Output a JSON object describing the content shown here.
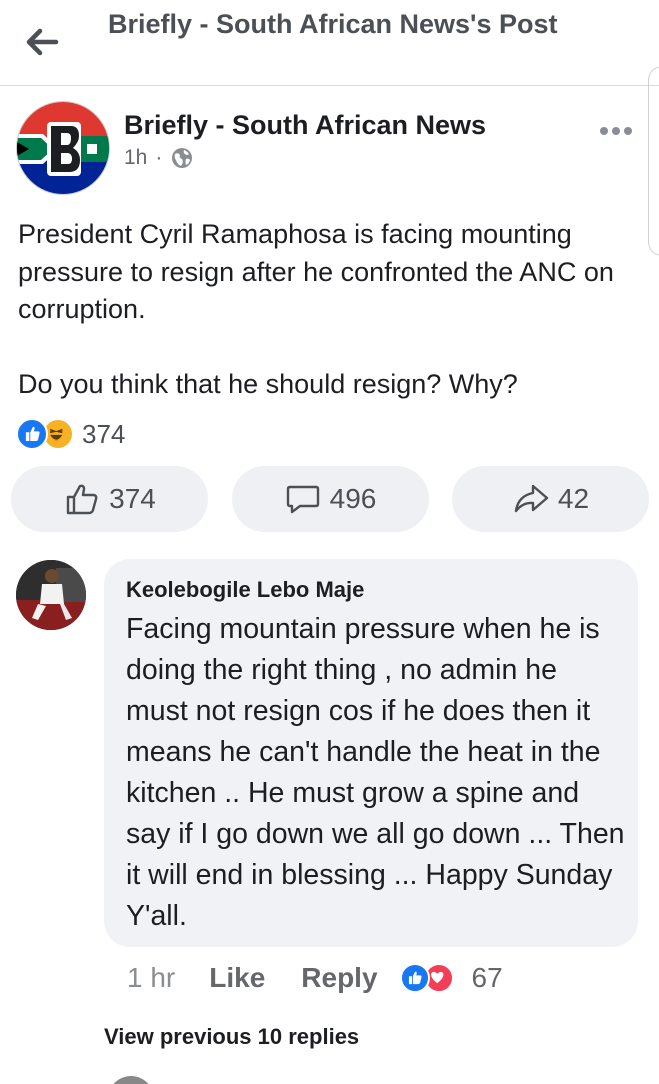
{
  "header": {
    "title": "Briefly - South African News's Post"
  },
  "post": {
    "page_name": "Briefly - South African News",
    "time": "1h",
    "separator": "·",
    "text_1": "President Cyril Ramaphosa is facing mounting pressure to resign after he confronted the ANC on corruption.",
    "text_2": "Do you think that he should resign? Why?",
    "reaction_count": "374",
    "brand_colors": {
      "red": "#de3831",
      "blue": "#002395",
      "green": "#007a4d",
      "black": "#000000",
      "gold": "#ffb612"
    }
  },
  "actions": {
    "like_count": "374",
    "comment_count": "496",
    "share_count": "42"
  },
  "comment": {
    "author": "Keolebogile Lebo Maje",
    "text": "Facing mountain pressure when he is doing the right thing , no admin he must not resign cos if he does then it means he  can't handle the heat in the kitchen ..  He must grow a spine  and say if I go down we all go down ... Then it will end in blessing ... Happy Sunday Y'all.",
    "time": "1 hr",
    "like_label": "Like",
    "reply_label": "Reply",
    "reaction_count": "67"
  },
  "view_previous": "View previous 10 replies",
  "icons": {
    "back": "arrow-left-icon",
    "globe": "globe-icon",
    "more": "more-horizontal-icon",
    "like": "thumbs-up-icon",
    "comment": "comment-bubble-icon",
    "share": "share-arrow-icon"
  }
}
